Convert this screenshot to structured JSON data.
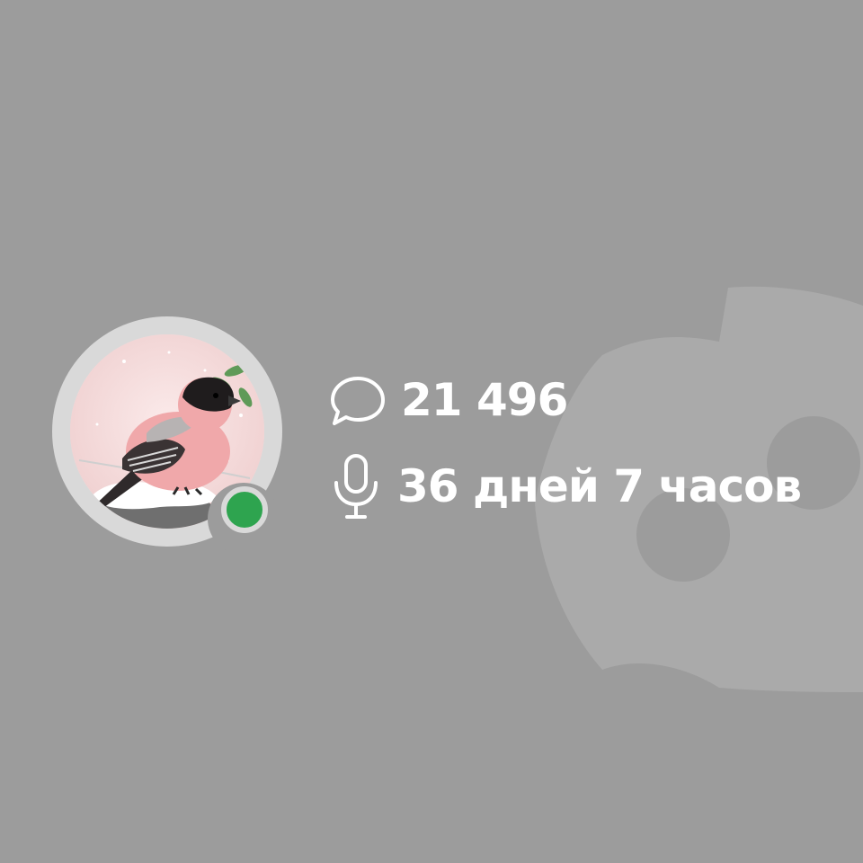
{
  "profile": {
    "avatar_subject": "bullfinch-on-snowy-stump",
    "status": "online",
    "status_color": "#2ea44f"
  },
  "stats": {
    "messages_icon": "chat-bubble-icon",
    "messages_count": "21 496",
    "voice_icon": "microphone-icon",
    "voice_time": "36 дней 7 часов"
  },
  "theme": {
    "background": "#9c9c9c",
    "watermark": "discord-logo-icon",
    "text_color": "#ffffff"
  }
}
